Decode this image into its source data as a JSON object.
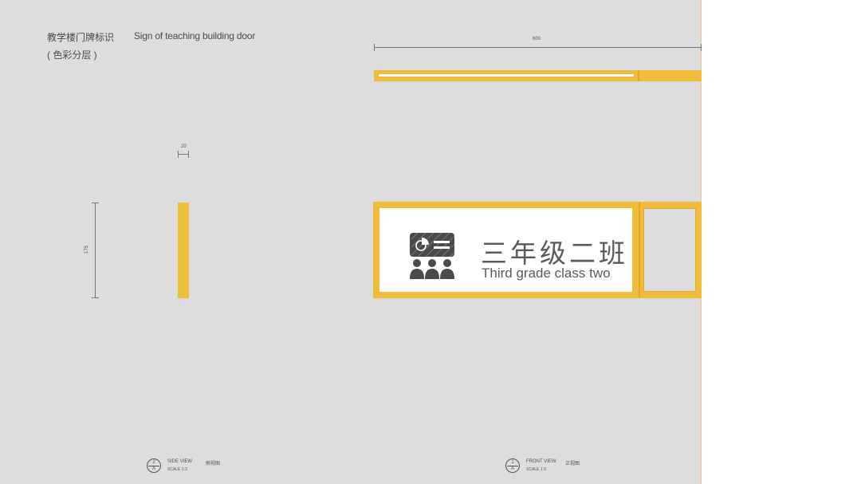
{
  "title": {
    "zh": "教学楼门牌标识",
    "en": "Sign of teaching building door",
    "sub": "( 色彩分层 )"
  },
  "dimensions": {
    "width_total": "600",
    "thickness": "20",
    "height": "175"
  },
  "sign": {
    "zh": "三年级二班",
    "en": "Third grade class two",
    "icon": "classroom-icon"
  },
  "views": {
    "side": {
      "num": "2",
      "sheet": "A",
      "title": "SIDE VIEW",
      "title_zh": "侧视图",
      "scale": "SCALE 1:3"
    },
    "front": {
      "num": "1",
      "sheet": "A",
      "title": "FRONT VIEW",
      "title_zh": "正视图",
      "scale": "SCALE 1:3"
    }
  },
  "colors": {
    "frame": "#f0bc3c",
    "background": "#dcdddc",
    "panel": "#ffffff",
    "text": "#5a5a5a"
  }
}
